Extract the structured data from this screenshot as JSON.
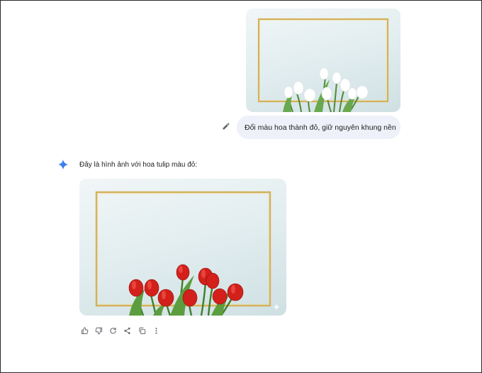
{
  "conversation": {
    "user_message": {
      "text": "Đổi màu hoa thành đỏ, giữ nguyên khung nền",
      "image": {
        "subject": "white-tulips-gold-frame",
        "flower_color": "#ffffff"
      }
    },
    "model_response": {
      "text": "Đây là hình ảnh với hoa tulip màu đỏ:",
      "image": {
        "subject": "red-tulips-gold-frame",
        "flower_color": "#d3201b"
      }
    }
  },
  "icons": {
    "edit": "pencil-icon",
    "assistant": "sparkle-icon",
    "actions": [
      "thumbs-up-icon",
      "thumbs-down-icon",
      "regenerate-icon",
      "share-icon",
      "copy-icon",
      "more-vertical-icon"
    ]
  },
  "colors": {
    "user_bubble": "#eef1fa",
    "frame_gold": "#d4b15a",
    "assistant_blue": "#4285f4",
    "icon_gray": "#5f6368"
  }
}
